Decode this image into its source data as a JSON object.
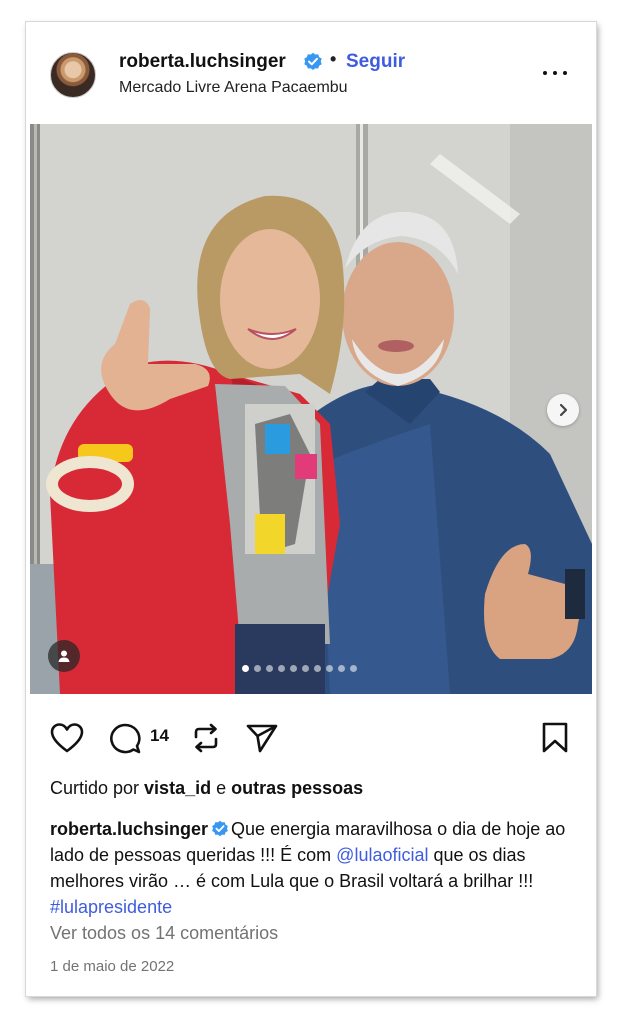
{
  "post": {
    "username": "roberta.luchsinger",
    "separator": "•",
    "follow_label": "Seguir",
    "location": "Mercado Livre Arena Pacaembu",
    "carousel": {
      "total_slides": 10,
      "active_slide": 1
    },
    "comment_count": "14",
    "liked_by_prefix": "Curtido por ",
    "liked_by_user": "vista_id",
    "liked_by_joiner": " e ",
    "liked_by_others": "outras pessoas",
    "caption": {
      "user": "roberta.luchsinger",
      "text_1": "Que energia maravilhosa o dia de hoje ao lado de pessoas queridas !!! É com ",
      "mention": "@lulaoficial",
      "text_2": " que os dias melhores virão … é com Lula que o Brasil voltará a brilhar !!! ",
      "hashtag": "#lulapresidente"
    },
    "view_comments": "Ver todos os 14 comentários",
    "date": "1 de maio de 2022"
  },
  "icons": {
    "verified": "verified-badge-icon",
    "more": "more-options-icon",
    "next": "chevron-right-icon",
    "tag": "user-tag-icon",
    "like": "heart-icon",
    "comment": "comment-icon",
    "repost": "repost-icon",
    "share": "send-icon",
    "save": "bookmark-icon"
  },
  "colors": {
    "link": "#3f5ce0",
    "verified": "#3897f0",
    "muted": "#737373"
  }
}
